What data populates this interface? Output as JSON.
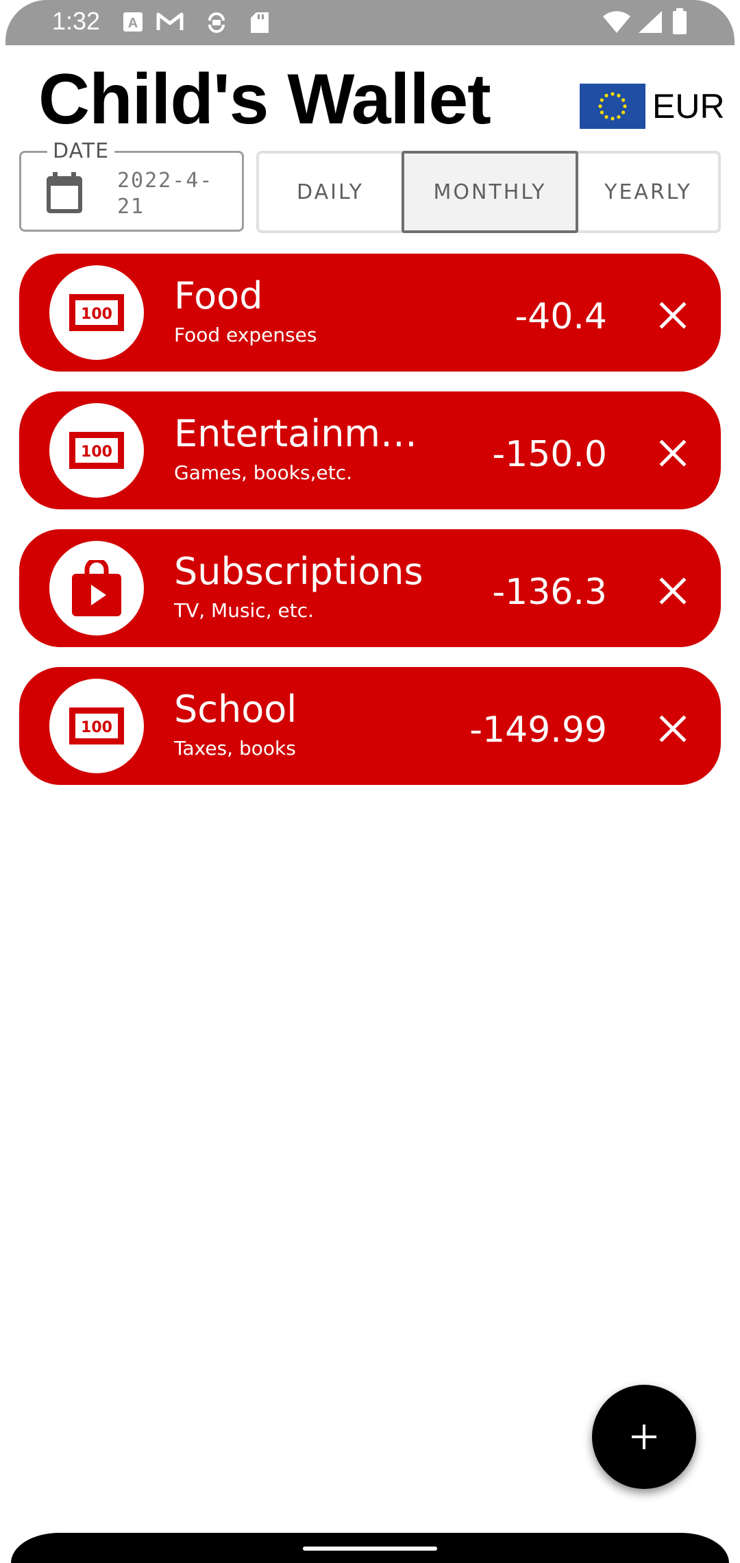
{
  "status_bar": {
    "time": "1:32"
  },
  "header": {
    "title": "Child's Wallet",
    "currency": "EUR"
  },
  "filters": {
    "date_label": "DATE",
    "date_value": "2022-4-21",
    "periods": [
      "DAILY",
      "MONTHLY",
      "YEARLY"
    ],
    "selected_period": "MONTHLY"
  },
  "expenses": [
    {
      "name": "Food",
      "description": "Food expenses",
      "amount": "-40.4",
      "icon": "banknote-icon"
    },
    {
      "name": "Entertainment",
      "description": "Games, books,etc.",
      "amount": "-150.0",
      "icon": "banknote-icon"
    },
    {
      "name": "Subscriptions",
      "description": "TV, Music, etc.",
      "amount": "-136.3",
      "icon": "shopping-bag-play-icon"
    },
    {
      "name": "School",
      "description": "Taxes, books",
      "amount": "-149.99",
      "icon": "banknote-icon"
    }
  ],
  "colors": {
    "card_background": "#d20000",
    "status_bar": "#9a9a9a",
    "eu_flag_blue": "#1f4ea3",
    "eu_flag_star": "#ffdd00"
  }
}
